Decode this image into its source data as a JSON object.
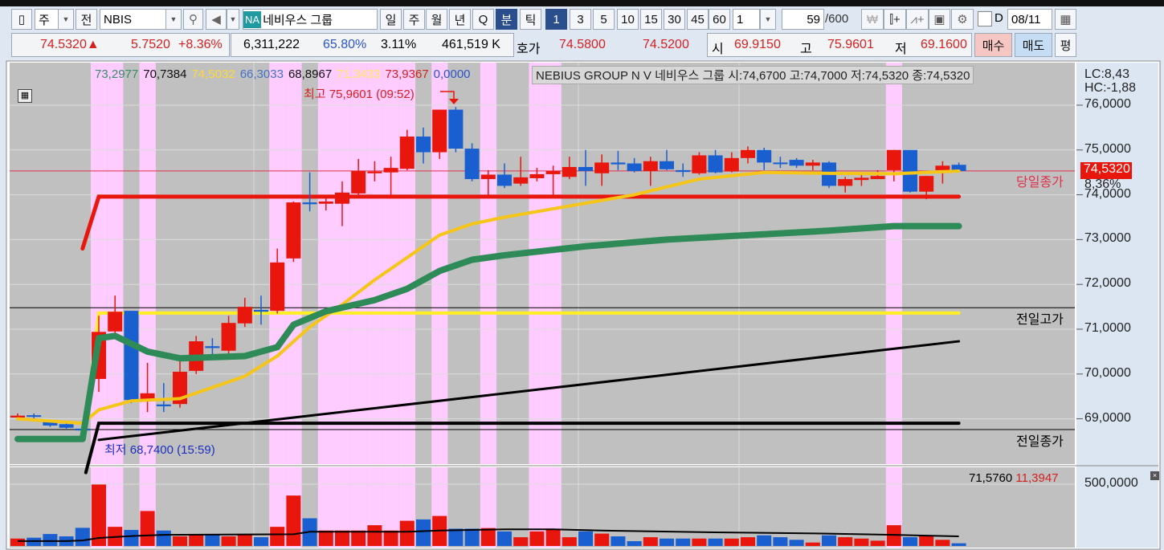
{
  "toolbar": {
    "market_select": "주",
    "prev_button": "전",
    "symbol": "NBIS",
    "badge": "NA",
    "stock_name": "네비우스 그룹",
    "period_buttons": [
      "일",
      "주",
      "월",
      "년",
      "Q",
      "분",
      "틱"
    ],
    "active_period": "분",
    "minute_buttons": [
      "1",
      "3",
      "5",
      "10",
      "15",
      "30",
      "45",
      "60"
    ],
    "active_minute": "1",
    "interval_value": "1",
    "count_value": "59",
    "count_total": "/600",
    "date_checkbox_label": "D",
    "date_value": "08/11"
  },
  "quote": {
    "price": "74.5320",
    "arrow": "▲",
    "change": "5.7520",
    "change_pct": "+8.36%",
    "volume": "6,311,222",
    "vol_ratio": "65.80%",
    "turnover": "3.11%",
    "amount": "461,519 K",
    "hoga_label": "호가",
    "ask": "74.5800",
    "bid": "74.5200",
    "open_label": "시",
    "open": "69.9150",
    "high_label": "고",
    "high": "75.9601",
    "low_label": "저",
    "low": "69.1600",
    "buy_button": "매수",
    "sell_button": "매도",
    "avg_button": "평"
  },
  "legend": {
    "values": [
      {
        "text": "73,2977",
        "color": "#3a8a6a"
      },
      {
        "text": "70,7384",
        "color": "#111111"
      },
      {
        "text": "74,5032",
        "color": "#ffd83a"
      },
      {
        "text": "66,3033",
        "color": "#4472c4"
      },
      {
        "text": "68,8967",
        "color": "#111111"
      },
      {
        "text": "71,3433",
        "color": "#ffe85a"
      },
      {
        "text": "73,9367",
        "color": "#d42020"
      },
      {
        "text": "0,0000",
        "color": "#2a55c8"
      }
    ],
    "info": "NEBIUS GROUP N V  네비우스 그룹 시:74,6700 고:74,7000 저:74,5320 종:74,5320"
  },
  "annotations": {
    "high": "최고 75,9601 (09:52)",
    "low": "최저 68,7400 (15:59)",
    "today_close": "당일종가",
    "prev_high": "전일고가",
    "prev_close": "전일종가"
  },
  "axis": {
    "lc": "LC:8,43",
    "hc": "HC:-1,88",
    "ticks": [
      "76,0000",
      "75,0000",
      "74,0000",
      "73,0000",
      "72,0000",
      "71,0000",
      "70,0000",
      "69,0000"
    ],
    "current_price": "74,5320",
    "current_pct": "8,36%",
    "volume_tick": "500,0000",
    "volume_ma": "71,5760",
    "volume_value": "11,3947"
  },
  "colors": {
    "up": "#e8160c",
    "down": "#1a5fd0",
    "band": "#ffccff",
    "plot_bg": "#c0c0c0"
  },
  "chart_data": {
    "type": "candlestick",
    "ylim": [
      67.7,
      76.9
    ],
    "price_ticks": [
      76,
      75,
      74,
      73,
      72,
      71,
      70,
      69
    ],
    "ohlc": [
      [
        69.03,
        69.12,
        68.97,
        69.07
      ],
      [
        69.08,
        69.12,
        69.0,
        69.05
      ],
      [
        68.93,
        68.96,
        68.82,
        68.85
      ],
      [
        68.88,
        68.9,
        68.78,
        68.8
      ],
      [
        68.78,
        68.8,
        68.74,
        68.74
      ],
      [
        69.89,
        71.3,
        69.6,
        70.94
      ],
      [
        70.95,
        71.75,
        70.9,
        71.39
      ],
      [
        71.41,
        71.41,
        69.35,
        69.42
      ],
      [
        69.42,
        70.25,
        69.15,
        69.57
      ],
      [
        69.32,
        69.8,
        69.15,
        69.28
      ],
      [
        69.33,
        70.3,
        69.25,
        70.05
      ],
      [
        70.07,
        70.85,
        70.0,
        70.73
      ],
      [
        70.62,
        70.8,
        70.4,
        70.58
      ],
      [
        70.52,
        71.3,
        70.45,
        71.14
      ],
      [
        71.13,
        71.7,
        71.05,
        71.5
      ],
      [
        71.43,
        71.75,
        71.1,
        71.39
      ],
      [
        71.41,
        72.8,
        71.35,
        72.49
      ],
      [
        72.58,
        73.85,
        72.5,
        73.83
      ],
      [
        73.83,
        74.5,
        73.63,
        73.79
      ],
      [
        73.8,
        74.0,
        73.65,
        73.85
      ],
      [
        73.8,
        74.3,
        73.3,
        74.05
      ],
      [
        74.03,
        74.8,
        74.0,
        74.53
      ],
      [
        74.48,
        74.75,
        74.3,
        74.52
      ],
      [
        74.5,
        74.85,
        73.95,
        74.6
      ],
      [
        74.58,
        75.45,
        74.55,
        75.3
      ],
      [
        75.3,
        75.5,
        74.7,
        74.95
      ],
      [
        74.95,
        75.9,
        74.8,
        75.9
      ],
      [
        75.9,
        75.96,
        74.95,
        75.03
      ],
      [
        75.03,
        75.15,
        74.3,
        74.35
      ],
      [
        74.35,
        74.55,
        74.0,
        74.45
      ],
      [
        74.45,
        74.7,
        74.15,
        74.2
      ],
      [
        74.25,
        74.85,
        74.2,
        74.39
      ],
      [
        74.37,
        74.6,
        74.3,
        74.46
      ],
      [
        74.46,
        74.65,
        74.0,
        74.53
      ],
      [
        74.4,
        74.85,
        74.35,
        74.62
      ],
      [
        74.62,
        75.0,
        74.2,
        74.53
      ],
      [
        74.48,
        74.9,
        74.2,
        74.72
      ],
      [
        74.72,
        74.98,
        74.55,
        74.68
      ],
      [
        74.7,
        74.82,
        74.5,
        74.53
      ],
      [
        74.53,
        74.85,
        74.2,
        74.75
      ],
      [
        74.75,
        75.0,
        74.55,
        74.57
      ],
      [
        74.55,
        74.7,
        74.4,
        74.51
      ],
      [
        74.48,
        74.95,
        74.45,
        74.88
      ],
      [
        74.88,
        75.0,
        74.48,
        74.5
      ],
      [
        74.52,
        74.95,
        74.5,
        74.82
      ],
      [
        74.82,
        75.08,
        74.7,
        75.0
      ],
      [
        75.0,
        75.05,
        74.55,
        74.72
      ],
      [
        74.72,
        74.85,
        74.6,
        74.7
      ],
      [
        74.78,
        74.82,
        74.6,
        74.65
      ],
      [
        74.65,
        74.78,
        74.55,
        74.72
      ],
      [
        74.72,
        74.75,
        74.15,
        74.2
      ],
      [
        74.2,
        74.4,
        74.05,
        74.35
      ],
      [
        74.33,
        74.45,
        74.2,
        74.38
      ],
      [
        74.35,
        74.55,
        74.35,
        74.42
      ],
      [
        74.55,
        75.0,
        74.3,
        75.0
      ],
      [
        75.0,
        75.0,
        74.05,
        74.07
      ],
      [
        74.07,
        74.42,
        73.9,
        74.42
      ],
      [
        74.55,
        74.75,
        74.25,
        74.65
      ],
      [
        74.67,
        74.72,
        74.5,
        74.53
      ]
    ],
    "volume": [
      60000,
      67000,
      97000,
      78000,
      147000,
      497000,
      155000,
      130000,
      283000,
      125000,
      78000,
      90000,
      90000,
      78000,
      90000,
      71000,
      155000,
      408000,
      224000,
      125000,
      125000,
      125000,
      168000,
      125000,
      204000,
      215000,
      243000,
      140000,
      140000,
      145000,
      118000,
      71000,
      118000,
      130000,
      71000,
      118000,
      100000,
      78000,
      39000,
      71000,
      60000,
      60000,
      60000,
      60000,
      60000,
      71000,
      86000,
      71000,
      50000,
      28000,
      86000,
      71000,
      60000,
      43000,
      168000,
      71000,
      86000,
      50000,
      22000
    ],
    "volume_max_tick": 500000,
    "highlight_indices": [
      5,
      6,
      8,
      16,
      17,
      19,
      20,
      21,
      22,
      23,
      24,
      26,
      29,
      32,
      33,
      54
    ],
    "lines": [
      {
        "color": "#e8160c",
        "width": 5,
        "points": [
          [
            4,
            72.8
          ],
          [
            5,
            73.96
          ],
          [
            58,
            73.96
          ]
        ]
      },
      {
        "color": "#ffee22",
        "width": 4,
        "points": [
          [
            4.2,
            68.95
          ],
          [
            5,
            71.36
          ],
          [
            58,
            71.36
          ]
        ]
      },
      {
        "color": "#000000",
        "width": 4,
        "points": [
          [
            4.2,
            67.8
          ],
          [
            5,
            68.9
          ],
          [
            58,
            68.9
          ]
        ]
      },
      {
        "color": "#000000",
        "width": 3,
        "points": [
          [
            5,
            68.53
          ],
          [
            58,
            70.73
          ]
        ]
      },
      {
        "color": "#f5c518",
        "width": 4,
        "points": [
          [
            0,
            69.0
          ],
          [
            4,
            68.9
          ],
          [
            5,
            69.2
          ],
          [
            7,
            69.4
          ],
          [
            10,
            69.45
          ],
          [
            14,
            69.95
          ],
          [
            16,
            70.4
          ],
          [
            18,
            71.05
          ],
          [
            20,
            71.55
          ],
          [
            22,
            72.1
          ],
          [
            24,
            72.6
          ],
          [
            26,
            73.1
          ],
          [
            28,
            73.35
          ],
          [
            30,
            73.5
          ],
          [
            34,
            73.75
          ],
          [
            38,
            74.0
          ],
          [
            42,
            74.35
          ],
          [
            46,
            74.5
          ],
          [
            50,
            74.48
          ],
          [
            54,
            74.47
          ],
          [
            58,
            74.53
          ]
        ]
      },
      {
        "color": "#2e8b57",
        "width": 8,
        "points": [
          [
            0,
            68.55
          ],
          [
            4,
            68.55
          ],
          [
            5,
            70.8
          ],
          [
            6,
            70.85
          ],
          [
            8,
            70.5
          ],
          [
            10,
            70.35
          ],
          [
            14,
            70.4
          ],
          [
            16,
            70.6
          ],
          [
            17,
            71.1
          ],
          [
            19,
            71.4
          ],
          [
            22,
            71.65
          ],
          [
            24,
            71.9
          ],
          [
            26,
            72.3
          ],
          [
            28,
            72.55
          ],
          [
            30,
            72.65
          ],
          [
            35,
            72.85
          ],
          [
            40,
            73.0
          ],
          [
            45,
            73.1
          ],
          [
            50,
            73.2
          ],
          [
            54,
            73.3
          ],
          [
            58,
            73.3
          ]
        ]
      }
    ],
    "reference_lines": {
      "today_close": 74.532,
      "prev_high": 71.48,
      "prev_close": 68.76
    },
    "volume_ma": [
      [
        0,
        40000
      ],
      [
        3,
        40000
      ],
      [
        4,
        45000
      ],
      [
        5,
        65000
      ],
      [
        7,
        80000
      ],
      [
        9,
        90000
      ],
      [
        17,
        95000
      ],
      [
        18,
        115000
      ],
      [
        24,
        115000
      ],
      [
        26,
        125000
      ],
      [
        30,
        135000
      ],
      [
        33,
        135000
      ],
      [
        36,
        125000
      ],
      [
        43,
        110000
      ],
      [
        50,
        100000
      ],
      [
        54,
        90000
      ],
      [
        58,
        78000
      ]
    ]
  }
}
